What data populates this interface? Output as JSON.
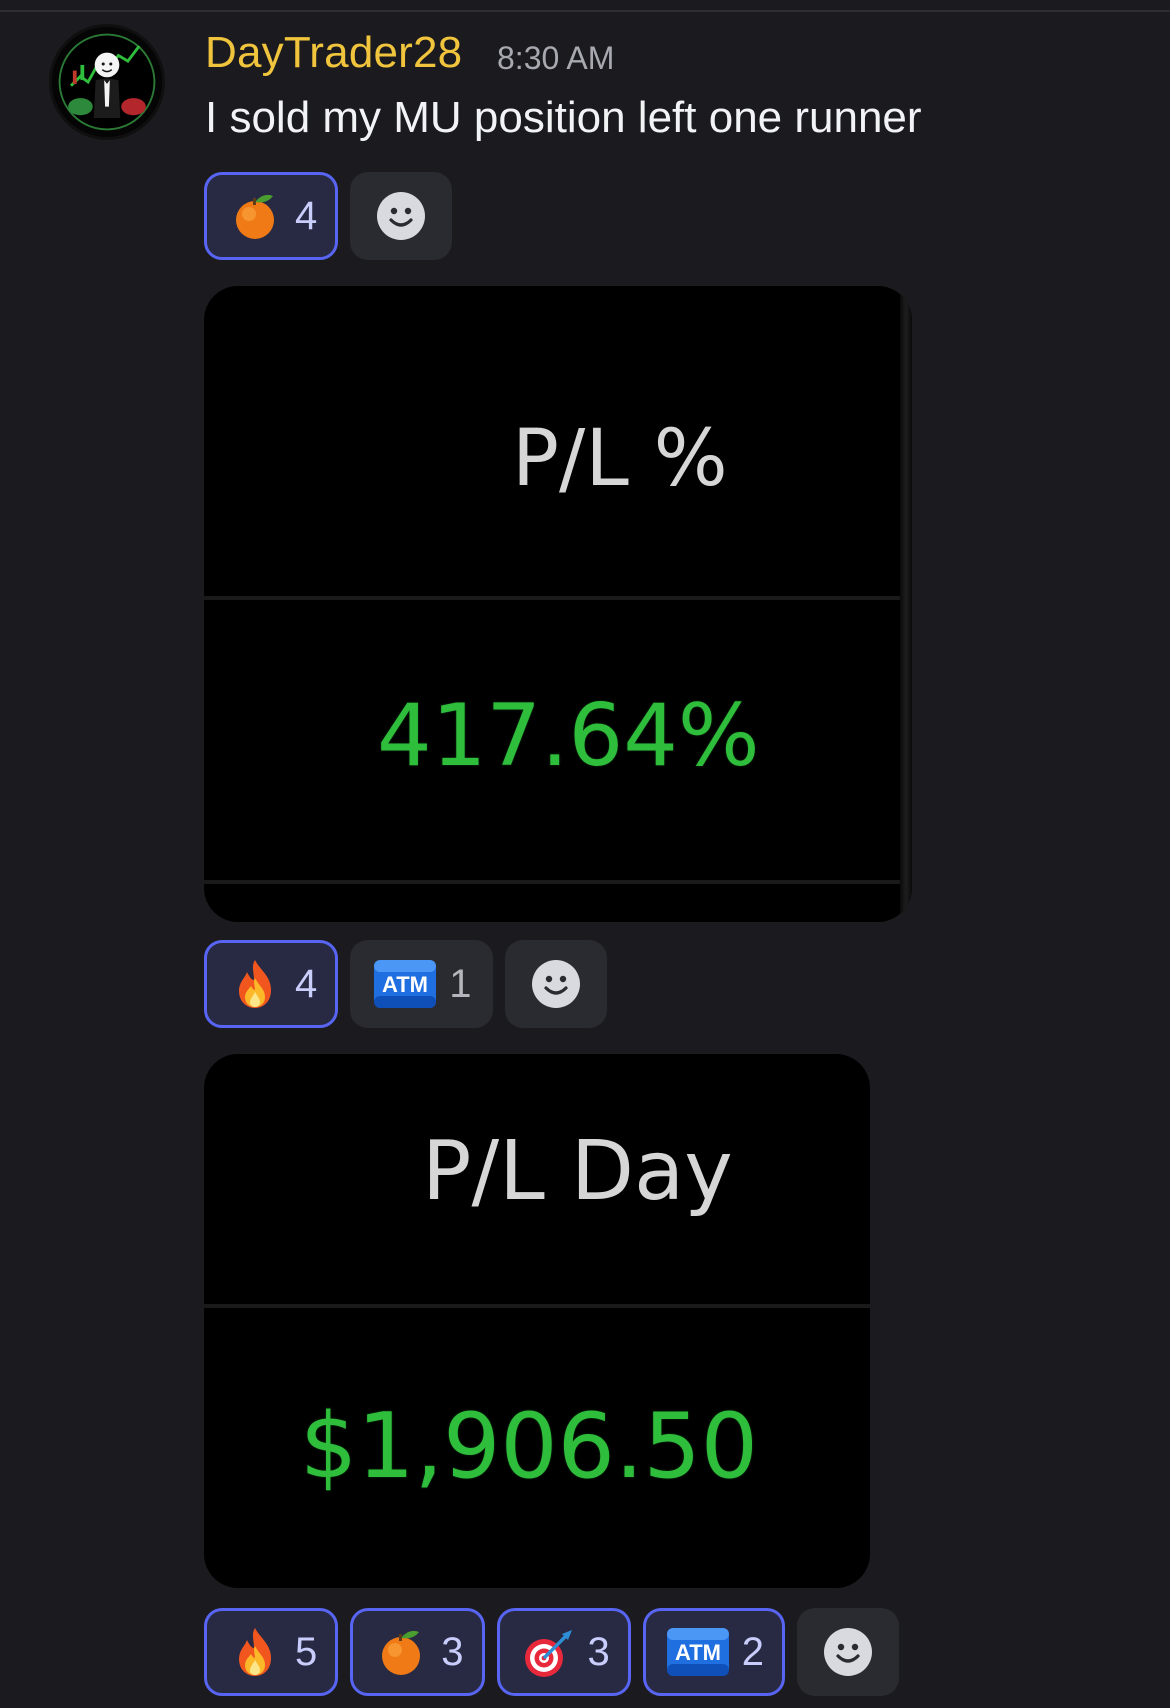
{
  "message": {
    "username": "DayTrader28",
    "timestamp": "8:30 AM",
    "text": "I sold my MU position left one runner"
  },
  "reactions_1": [
    {
      "emoji": "tangerine-emoji",
      "count": "4",
      "selected": true
    }
  ],
  "card_1": {
    "label": "P/L %",
    "value": "417.64%"
  },
  "reactions_2": [
    {
      "emoji": "fire-emoji",
      "count": "4",
      "selected": true
    },
    {
      "emoji": "atm-emoji",
      "count": "1",
      "selected": false
    }
  ],
  "card_2": {
    "label": "P/L Day",
    "value": "$1,906.50"
  },
  "reactions_3": [
    {
      "emoji": "fire-emoji",
      "count": "5",
      "selected": true
    },
    {
      "emoji": "tangerine-emoji",
      "count": "3",
      "selected": true
    },
    {
      "emoji": "direct-hit-emoji",
      "count": "3",
      "selected": true
    },
    {
      "emoji": "atm-emoji",
      "count": "2",
      "selected": true
    }
  ],
  "colors": {
    "background": "#1b1b1f",
    "username": "#f0c43c",
    "selected_reaction_border": "#5865f2",
    "profit_green": "#2fbd3c"
  }
}
